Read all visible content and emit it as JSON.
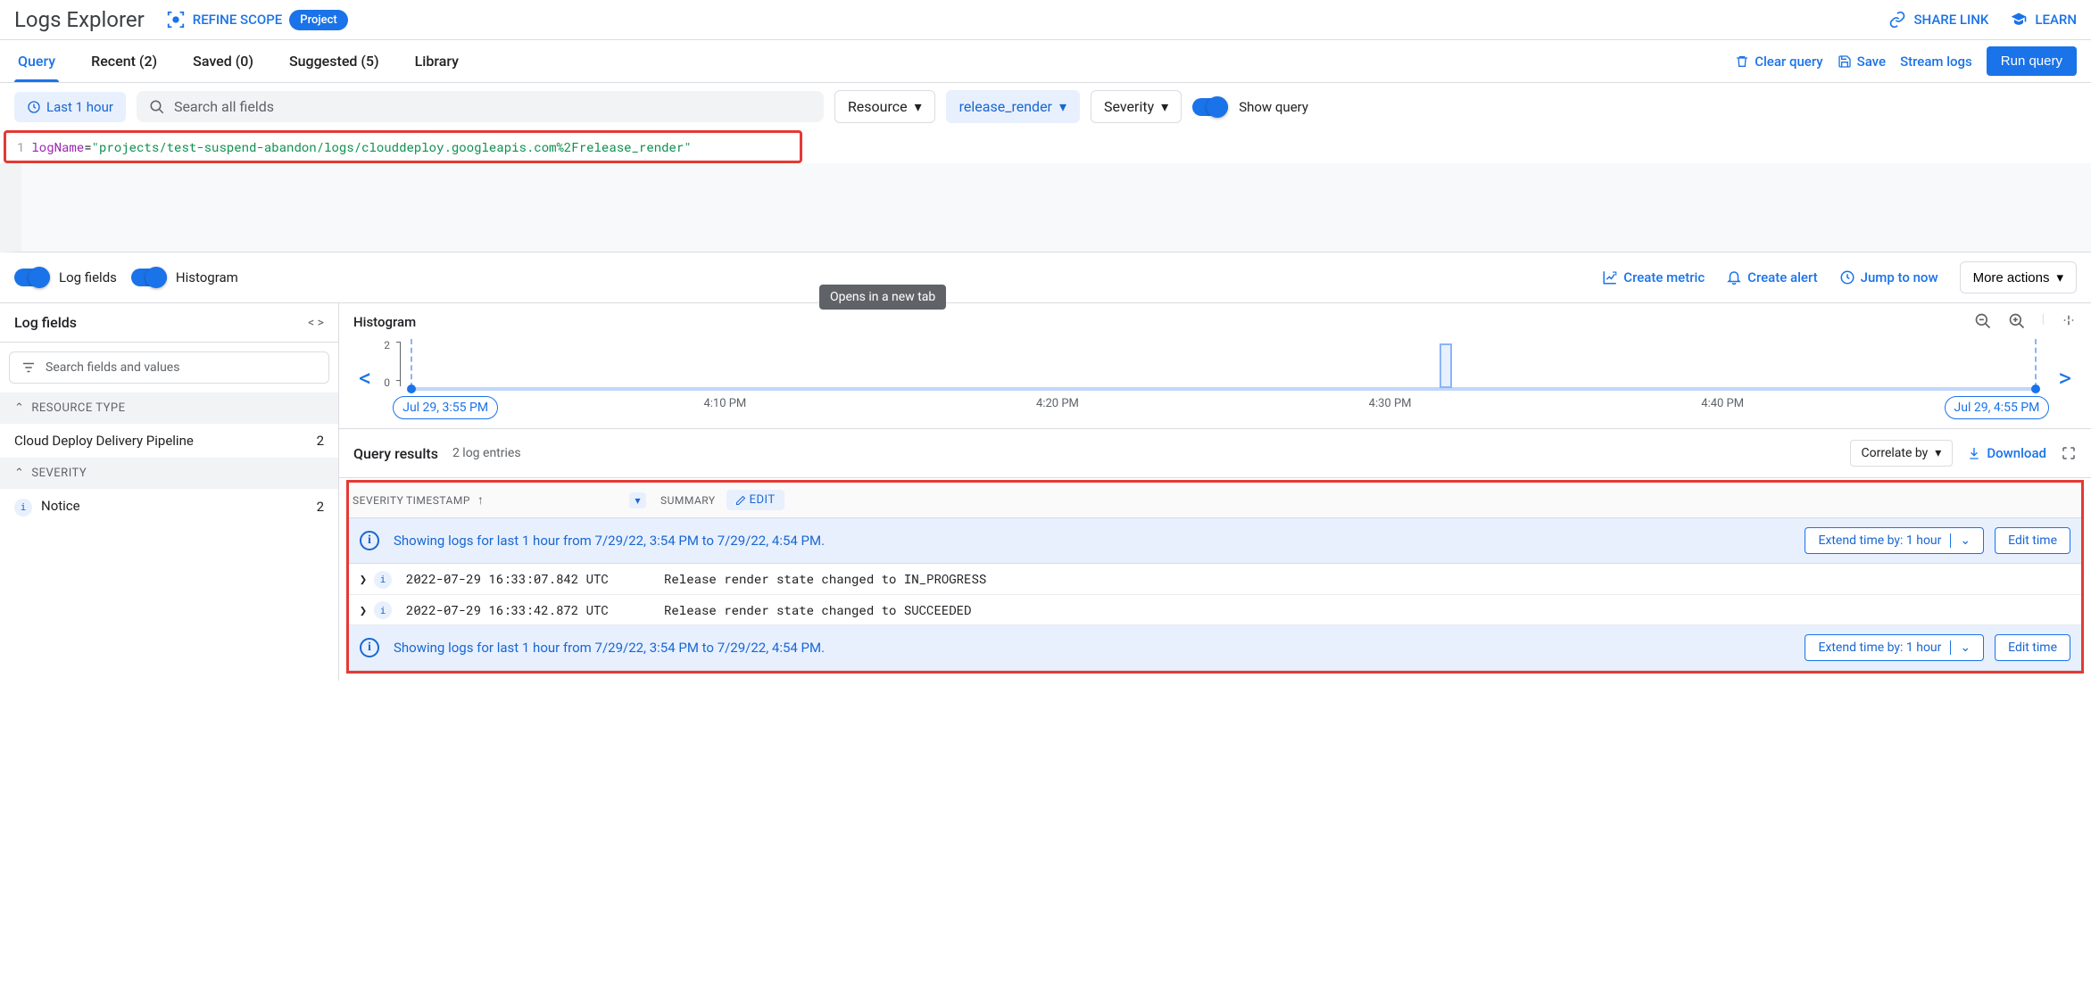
{
  "header": {
    "title": "Logs Explorer",
    "refine_scope": "REFINE SCOPE",
    "scope_chip": "Project",
    "share_link": "SHARE LINK",
    "learn": "LEARN"
  },
  "tabs": {
    "query": "Query",
    "recent": "Recent (2)",
    "saved": "Saved (0)",
    "suggested": "Suggested (5)",
    "library": "Library"
  },
  "tabs_actions": {
    "clear": "Clear query",
    "save": "Save",
    "stream": "Stream logs",
    "run": "Run query"
  },
  "filters": {
    "time_range": "Last 1 hour",
    "search_placeholder": "Search all fields",
    "resource": "Resource",
    "log_name": "release_render",
    "severity": "Severity",
    "show_query_label": "Show query"
  },
  "query": {
    "line_num": "1",
    "key": "logName",
    "value": "\"projects/test-suspend-abandon/logs/clouddeploy.googleapis.com%2Frelease_render\""
  },
  "toggles": {
    "log_fields": "Log fields",
    "histogram": "Histogram",
    "create_metric": "Create metric",
    "create_alert": "Create alert",
    "jump_to_now": "Jump to now",
    "more_actions": "More actions",
    "tooltip": "Opens in a new tab"
  },
  "sidebar": {
    "title": "Log fields",
    "search_placeholder": "Search fields and values",
    "section_resource": "RESOURCE TYPE",
    "resource_item": "Cloud Deploy Delivery Pipeline",
    "resource_count": "2",
    "section_severity": "SEVERITY",
    "severity_item": "Notice",
    "severity_count": "2"
  },
  "histogram": {
    "title": "Histogram",
    "y_top": "2",
    "y_bottom": "0",
    "ticks": [
      "4:10 PM",
      "4:20 PM",
      "4:30 PM",
      "4:40 PM"
    ],
    "start_badge": "Jul 29, 3:55 PM",
    "end_badge": "Jul 29, 4:55 PM"
  },
  "results": {
    "title": "Query results",
    "count": "2 log entries",
    "correlate": "Correlate by",
    "download": "Download",
    "col_severity": "SEVERITY",
    "col_timestamp": "TIMESTAMP",
    "col_summary": "SUMMARY",
    "edit": "EDIT",
    "info_text": "Showing logs for last 1 hour from 7/29/22, 3:54 PM to 7/29/22, 4:54 PM.",
    "extend": "Extend time by: 1 hour",
    "edit_time": "Edit time",
    "rows": [
      {
        "timestamp": "2022-07-29 16:33:07.842 UTC",
        "summary": "Release render state changed to IN_PROGRESS"
      },
      {
        "timestamp": "2022-07-29 16:33:42.872 UTC",
        "summary": "Release render state changed to SUCCEEDED"
      }
    ]
  }
}
